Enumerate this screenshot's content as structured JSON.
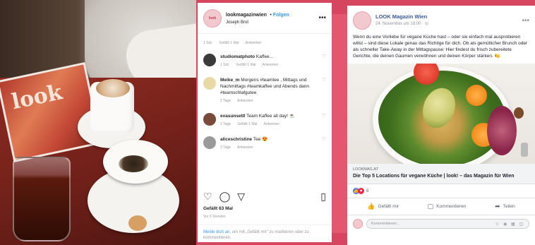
{
  "instagram": {
    "username": "lookmagazinwien",
    "follow_label": "Folgen",
    "location": "Joseph Brot",
    "top_meta": {
      "time": "1 Std.",
      "likes": "Gefällt 1 Mal",
      "reply": "Antworten"
    },
    "comments": [
      {
        "user": "studiomatphoto",
        "text": "Kaffee...",
        "time": "1 Std.",
        "likes": "Gefällt 1 Mal",
        "reply": "Antworten",
        "avatar_color": "#3a3a3a"
      },
      {
        "user": "Meike_m",
        "text": "Morgens #teamtee , Mittags und Nachmittags #teamkaffee und Abends dann #teamschlafgutee",
        "time": "2 Tage",
        "likes": "",
        "reply": "Antworten",
        "avatar_color": "#e8d9a6"
      },
      {
        "user": "evasunset0",
        "text": "Team Kaffee all day! ☕",
        "time": "2 Tage",
        "likes": "Gefällt 1 Mal",
        "reply": "Antworten",
        "avatar_color": "#7a4a3a"
      },
      {
        "user": "aliceschristine",
        "text": "Tee 😍",
        "time": "3 Tage",
        "likes": "",
        "reply": "Antworten",
        "avatar_color": "#9a9a9a"
      }
    ],
    "likes_total": "Gefällt 63 Mal",
    "posted": "Vor 3 Stunden",
    "footer_link": "Melde dich an,",
    "footer_text": "um mit „Gefällt mir“ zu markieren oder zu kommentieren."
  },
  "facebook": {
    "page_name": "LOOK Magazin Wien",
    "date": "24. November um 19:00",
    "post_text": "Wenn du eine Vorliebe für vegane Küche hast – oder sie einfach mal ausprobieren willst – sind diese Lokale genau das Richtige für dich. Ob als gemütlicher Brunch oder als schneller Take-Away in der Mittagspause: Hier findest du frisch zubereitete Gerichte, die deinen Gaumen verwöhnen und deinen Körper stärken. 🍋",
    "link_domain": "lookmag.at",
    "link_title": "Die Top 5 Locations für vegane Küche | look! – das Magazin für Wien",
    "reaction_count": "8",
    "buttons": {
      "like": "Gefällt mir",
      "comment": "Kommentieren",
      "share": "Teilen"
    },
    "comment_placeholder": "Kommentieren..."
  },
  "photo": {
    "magazine_label": "look"
  }
}
